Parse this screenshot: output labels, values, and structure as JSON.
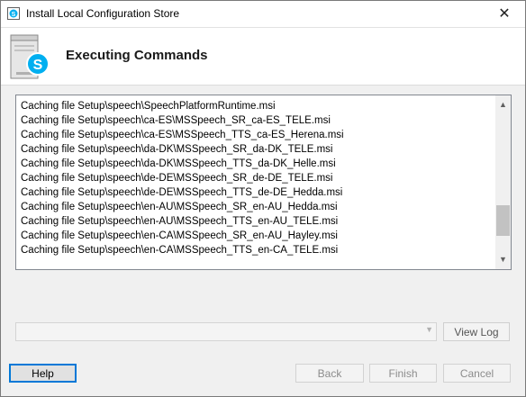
{
  "window": {
    "title": "Install Local Configuration Store",
    "close_glyph": "✕"
  },
  "header": {
    "title": "Executing Commands",
    "icon": "skype-server-icon"
  },
  "log": {
    "lines": [
      "Caching file Setup\\speech\\SpeechPlatformRuntime.msi",
      "Caching file Setup\\speech\\ca-ES\\MSSpeech_SR_ca-ES_TELE.msi",
      "Caching file Setup\\speech\\ca-ES\\MSSpeech_TTS_ca-ES_Herena.msi",
      "Caching file Setup\\speech\\da-DK\\MSSpeech_SR_da-DK_TELE.msi",
      "Caching file Setup\\speech\\da-DK\\MSSpeech_TTS_da-DK_Helle.msi",
      "Caching file Setup\\speech\\de-DE\\MSSpeech_SR_de-DE_TELE.msi",
      "Caching file Setup\\speech\\de-DE\\MSSpeech_TTS_de-DE_Hedda.msi",
      "Caching file Setup\\speech\\en-AU\\MSSpeech_SR_en-AU_Hedda.msi",
      "Caching file Setup\\speech\\en-AU\\MSSpeech_TTS_en-AU_TELE.msi",
      "Caching file Setup\\speech\\en-CA\\MSSpeech_SR_en-AU_Hayley.msi",
      "Caching file Setup\\speech\\en-CA\\MSSpeech_TTS_en-CA_TELE.msi"
    ],
    "scroll_position": 0.85
  },
  "combo": {
    "value": ""
  },
  "buttons": {
    "view_log": "View Log",
    "help": "Help",
    "back": "Back",
    "finish": "Finish",
    "cancel": "Cancel"
  }
}
